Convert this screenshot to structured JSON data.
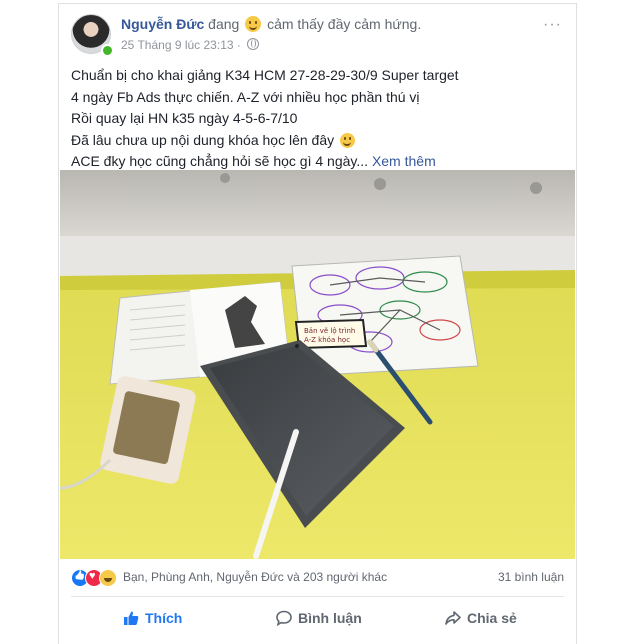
{
  "post": {
    "author": "Nguyễn Đức",
    "status_prefix": "đang",
    "feeling": "cảm thấy đầy cảm hứng.",
    "timestamp": "25 Tháng 9 lúc 23:13",
    "more_label": "···",
    "text_lines": [
      "Chuẩn bị cho khai giảng K34 HCM 27-28-29-30/9 Super target",
      "4 ngày Fb Ads thực chiến. A-Z với nhiều học phần thú vị",
      "Rồi quay lại HN k35 ngày 4-5-6-7/10",
      "Đã lâu chưa up nội dung khóa học lên đây",
      "ACE đky học cũng chẳng hỏi sẽ học gì 4 ngày..."
    ],
    "see_more": "Xem thêm"
  },
  "reactions": {
    "summary": "Bạn, Phùng Anh, Nguyễn Đức và 203 người khác",
    "comments": "31 bình luận"
  },
  "actions": {
    "like": "Thích",
    "comment": "Bình luận",
    "share": "Chia sẻ"
  },
  "photo": {
    "note_line1": "Bản vẽ lộ trình",
    "note_line2": "A-Z khóa học"
  }
}
